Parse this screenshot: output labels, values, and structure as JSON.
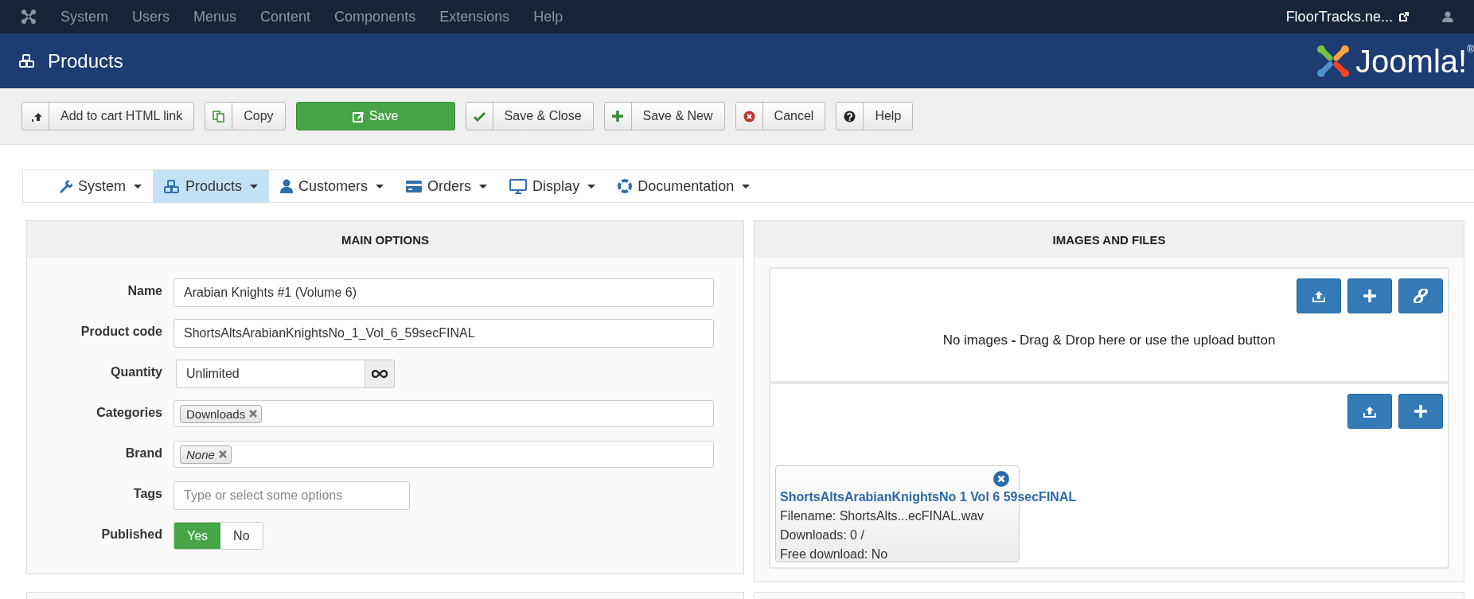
{
  "top_menu": {
    "items": [
      "System",
      "Users",
      "Menus",
      "Content",
      "Components",
      "Extensions",
      "Help"
    ],
    "site_link": "FloorTracks.ne..."
  },
  "header": {
    "title": "Products",
    "logo": {
      "text": "Joomla!",
      "mark": "®"
    }
  },
  "toolbar": [
    {
      "label": "Add to cart HTML link",
      "kind": "default"
    },
    {
      "label": "Copy",
      "kind": "default"
    },
    {
      "label": "Save",
      "kind": "primary"
    },
    {
      "label": "Save & Close",
      "kind": "default"
    },
    {
      "label": "Save & New",
      "kind": "default"
    },
    {
      "label": "Cancel",
      "kind": "default"
    },
    {
      "label": "Help",
      "kind": "default"
    }
  ],
  "submenu": [
    {
      "label": "System",
      "selected": false
    },
    {
      "label": "Products",
      "selected": true
    },
    {
      "label": "Customers",
      "selected": false
    },
    {
      "label": "Orders",
      "selected": false
    },
    {
      "label": "Display",
      "selected": false
    },
    {
      "label": "Documentation",
      "selected": false
    }
  ],
  "main_options": {
    "title": "MAIN OPTIONS",
    "fields": [
      {
        "label": "Name",
        "kind": "text",
        "value": "Arabian Knights #1 (Volume 6)"
      },
      {
        "label": "Product code",
        "kind": "text",
        "value": "ShortsAltsArabianKnightsNo_1_Vol_6_59secFINAL"
      },
      {
        "label": "Quantity",
        "kind": "quantity",
        "value": "Unlimited"
      },
      {
        "label": "Categories",
        "kind": "tags",
        "tags": [
          {
            "text": "Downloads",
            "kind": "value"
          }
        ]
      },
      {
        "label": "Brand",
        "kind": "tags",
        "tags": [
          {
            "text": "None",
            "kind": "empty"
          }
        ]
      },
      {
        "label": "Tags",
        "kind": "tag_input",
        "placeholder": "Type or select some options"
      },
      {
        "label": "Published",
        "kind": "toggle",
        "options": [
          {
            "label": "Yes",
            "selected": true
          },
          {
            "label": "No",
            "selected": false
          }
        ]
      }
    ]
  },
  "images_and_files": {
    "title": "IMAGES AND FILES",
    "images": {
      "message": "No images **-** Drag & Drop here or use the upload button"
    },
    "files": {
      "items": [
        {
          "title": "ShortsAltsArabianKnightsNo 1 Vol 6 59secFINAL",
          "lines": [
            "Filename: ShortsAlts...ecFINAL.wav",
            "Downloads: 0 /",
            "Free download: No"
          ]
        }
      ]
    }
  }
}
